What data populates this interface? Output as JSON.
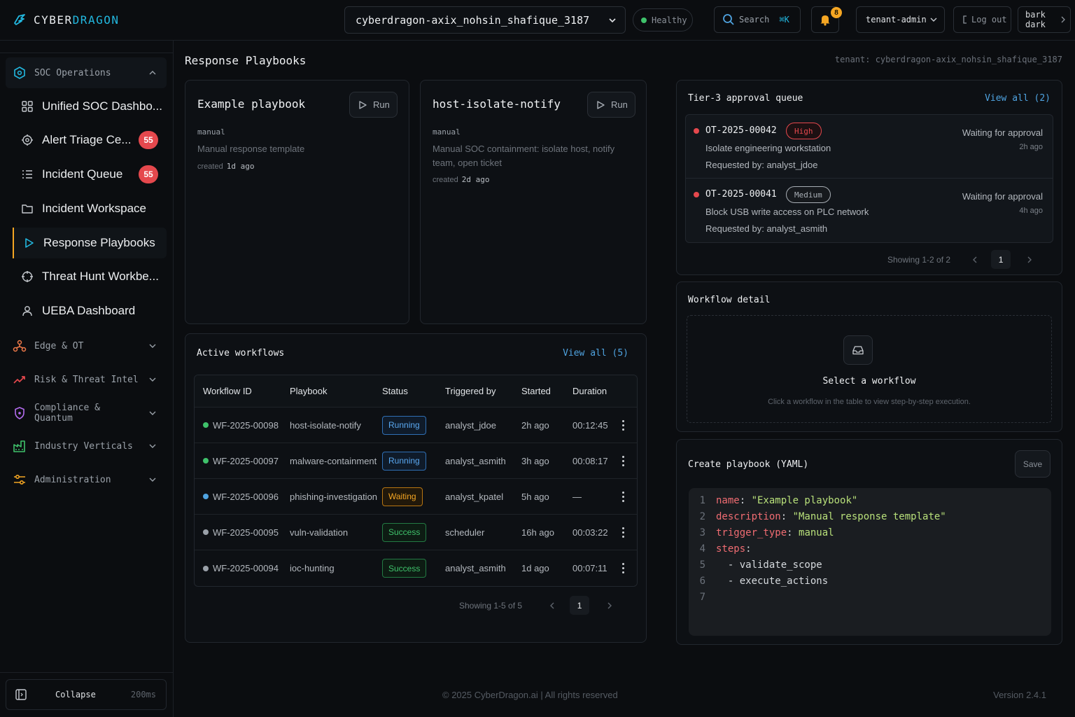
{
  "header": {
    "brand_part1": "CYBER",
    "brand_part2": "DRAGON",
    "tenant_select": "cyberdragon-axix_nohsin_shafique_3187",
    "health": "Healthy",
    "search_label": "Search",
    "search_shortcut": "⌘K",
    "notifications_count": "8",
    "role": "tenant-admin",
    "logout": "Log out",
    "theme_line1": "bark",
    "theme_line2": "dark"
  },
  "sidebar": {
    "soc_group": "SOC Operations",
    "items": [
      {
        "label": "Unified SOC Dashbo...",
        "badge": null
      },
      {
        "label": "Alert Triage Ce...",
        "badge": "55"
      },
      {
        "label": "Incident Queue",
        "badge": "55"
      },
      {
        "label": "Incident Workspace",
        "badge": null
      },
      {
        "label": "Response Playbooks",
        "badge": null
      },
      {
        "label": "Threat Hunt Workbe...",
        "badge": null
      },
      {
        "label": "UEBA Dashboard",
        "badge": null
      }
    ],
    "groups": [
      "Edge & OT",
      "Risk & Threat Intel",
      "Compliance & Quantum",
      "Industry Verticals",
      "Administration"
    ],
    "collapse_label": "Collapse",
    "collapse_time": "200ms"
  },
  "page": {
    "title": "Response Playbooks",
    "tenant_line": "tenant: cyberdragon-axix_nohsin_shafique_3187"
  },
  "playbooks": [
    {
      "name": "Example playbook",
      "run": "Run",
      "trigger": "manual",
      "description": "Manual response template",
      "created_label": "created",
      "created_value": "1d ago"
    },
    {
      "name": "host-isolate-notify",
      "run": "Run",
      "trigger": "manual",
      "description": "Manual SOC containment: isolate host, notify team, open ticket",
      "created_label": "created",
      "created_value": "2d ago"
    }
  ],
  "workflows": {
    "title": "Active workflows",
    "view_all": "View all (5)",
    "columns": [
      "Workflow ID",
      "Playbook",
      "Status",
      "Triggered by",
      "Started",
      "Duration"
    ],
    "rows": [
      {
        "id": "WF-2025-00098",
        "playbook": "host-isolate-notify",
        "status": "Running",
        "status_class": "running",
        "dot": "#3fc26b",
        "triggered_by": "analyst_jdoe",
        "started": "2h ago",
        "duration": "00:12:45"
      },
      {
        "id": "WF-2025-00097",
        "playbook": "malware-containment",
        "status": "Running",
        "status_class": "running",
        "dot": "#3fc26b",
        "triggered_by": "analyst_asmith",
        "started": "3h ago",
        "duration": "00:08:17"
      },
      {
        "id": "WF-2025-00096",
        "playbook": "phishing-investigation",
        "status": "Waiting",
        "status_class": "waiting",
        "dot": "#4fa3e0",
        "triggered_by": "analyst_kpatel",
        "started": "5h ago",
        "duration": "—"
      },
      {
        "id": "WF-2025-00095",
        "playbook": "vuln-validation",
        "status": "Success",
        "status_class": "success",
        "dot": "#9aa1a9",
        "triggered_by": "scheduler",
        "started": "16h ago",
        "duration": "00:03:22"
      },
      {
        "id": "WF-2025-00094",
        "playbook": "ioc-hunting",
        "status": "Success",
        "status_class": "success",
        "dot": "#9aa1a9",
        "triggered_by": "analyst_asmith",
        "started": "1d ago",
        "duration": "00:07:11"
      }
    ],
    "pager_text": "Showing 1-5 of 5",
    "page": "1"
  },
  "approvals": {
    "title": "Tier-3 approval queue",
    "view_all": "View all (2)",
    "items": [
      {
        "id": "OT-2025-00042",
        "severity": "High",
        "sev_class": "high",
        "title": "Isolate engineering workstation",
        "requested": "Requested by: analyst_jdoe",
        "state": "Waiting for approval",
        "time": "2h ago"
      },
      {
        "id": "OT-2025-00041",
        "severity": "Medium",
        "sev_class": "med",
        "title": "Block USB write access on PLC network",
        "requested": "Requested by: analyst_asmith",
        "state": "Waiting for approval",
        "time": "4h ago"
      }
    ],
    "pager_text": "Showing 1-2 of 2",
    "page": "1"
  },
  "workflow_detail": {
    "title": "Workflow detail",
    "empty_title": "Select a workflow",
    "empty_sub": "Click a workflow in the table to view step-by-step execution."
  },
  "create_playbook": {
    "title": "Create playbook (YAML)",
    "save": "Save",
    "lines": [
      {
        "n": "1",
        "indent": "",
        "key": "name",
        "sep": ": ",
        "val": "\"Example playbook\"",
        "vtype": "s"
      },
      {
        "n": "2",
        "indent": "",
        "key": "description",
        "sep": ": ",
        "val": "\"Manual response template\"",
        "vtype": "s"
      },
      {
        "n": "3",
        "indent": "",
        "key": "trigger_type",
        "sep": ": ",
        "val": "manual",
        "vtype": "s"
      },
      {
        "n": "4",
        "indent": "",
        "key": "steps",
        "sep": ":",
        "val": "",
        "vtype": "v"
      },
      {
        "n": "5",
        "indent": "  ",
        "key": "",
        "sep": "",
        "val": "- validate_scope",
        "vtype": "v"
      },
      {
        "n": "6",
        "indent": "  ",
        "key": "",
        "sep": "",
        "val": "- execute_actions",
        "vtype": "v"
      },
      {
        "n": "7",
        "indent": "",
        "key": "",
        "sep": "",
        "val": "",
        "vtype": "v"
      }
    ]
  },
  "footer": {
    "copyright": "© 2025 CyberDragon.ai  |  All rights reserved",
    "version": "Version 2.4.1"
  },
  "colors": {
    "accent": "#22b8e0",
    "active_marker": "#f5a623",
    "badge": "#e5484d",
    "link": "#4fa3e0"
  }
}
